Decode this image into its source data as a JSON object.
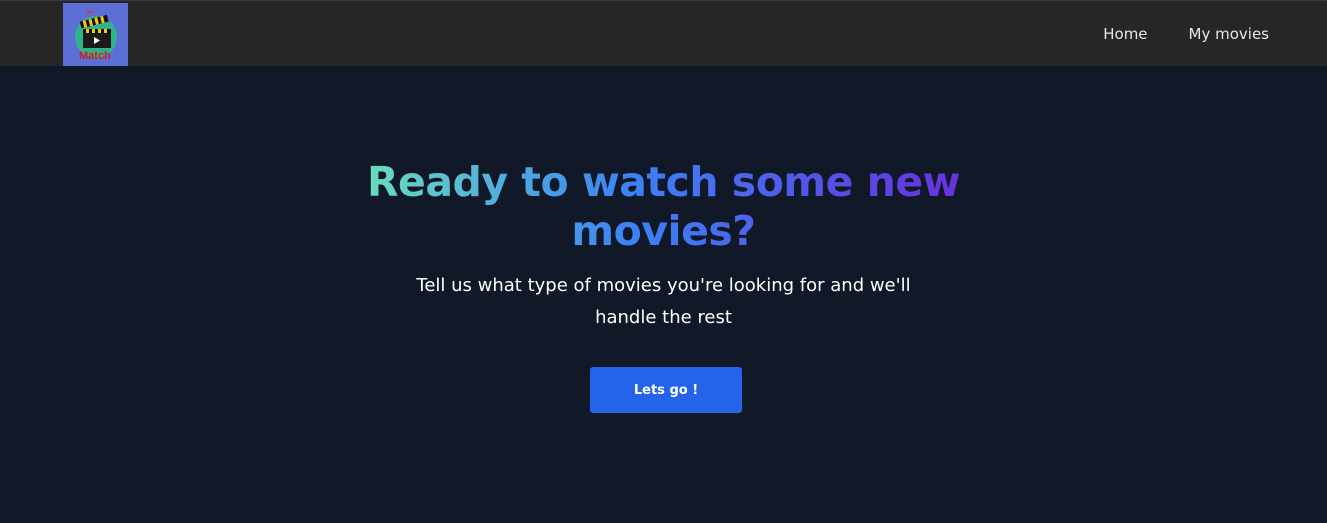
{
  "header": {
    "logo": {
      "icon": "film-clapperboard-icon",
      "text": "Match"
    },
    "nav": [
      {
        "label": "Home"
      },
      {
        "label": "My movies"
      }
    ]
  },
  "hero": {
    "title": "Ready to watch some new movies?",
    "subtitle": "Tell us what type of movies you're looking for and we'll handle the rest",
    "cta_label": "Lets go !"
  },
  "colors": {
    "header_bg": "#262626",
    "page_bg": "#111827",
    "logo_bg": "#5b6fd6",
    "cta_bg": "#2563eb",
    "title_gradient": [
      "#6ee7b7",
      "#3b82f6",
      "#6d28d9"
    ]
  }
}
